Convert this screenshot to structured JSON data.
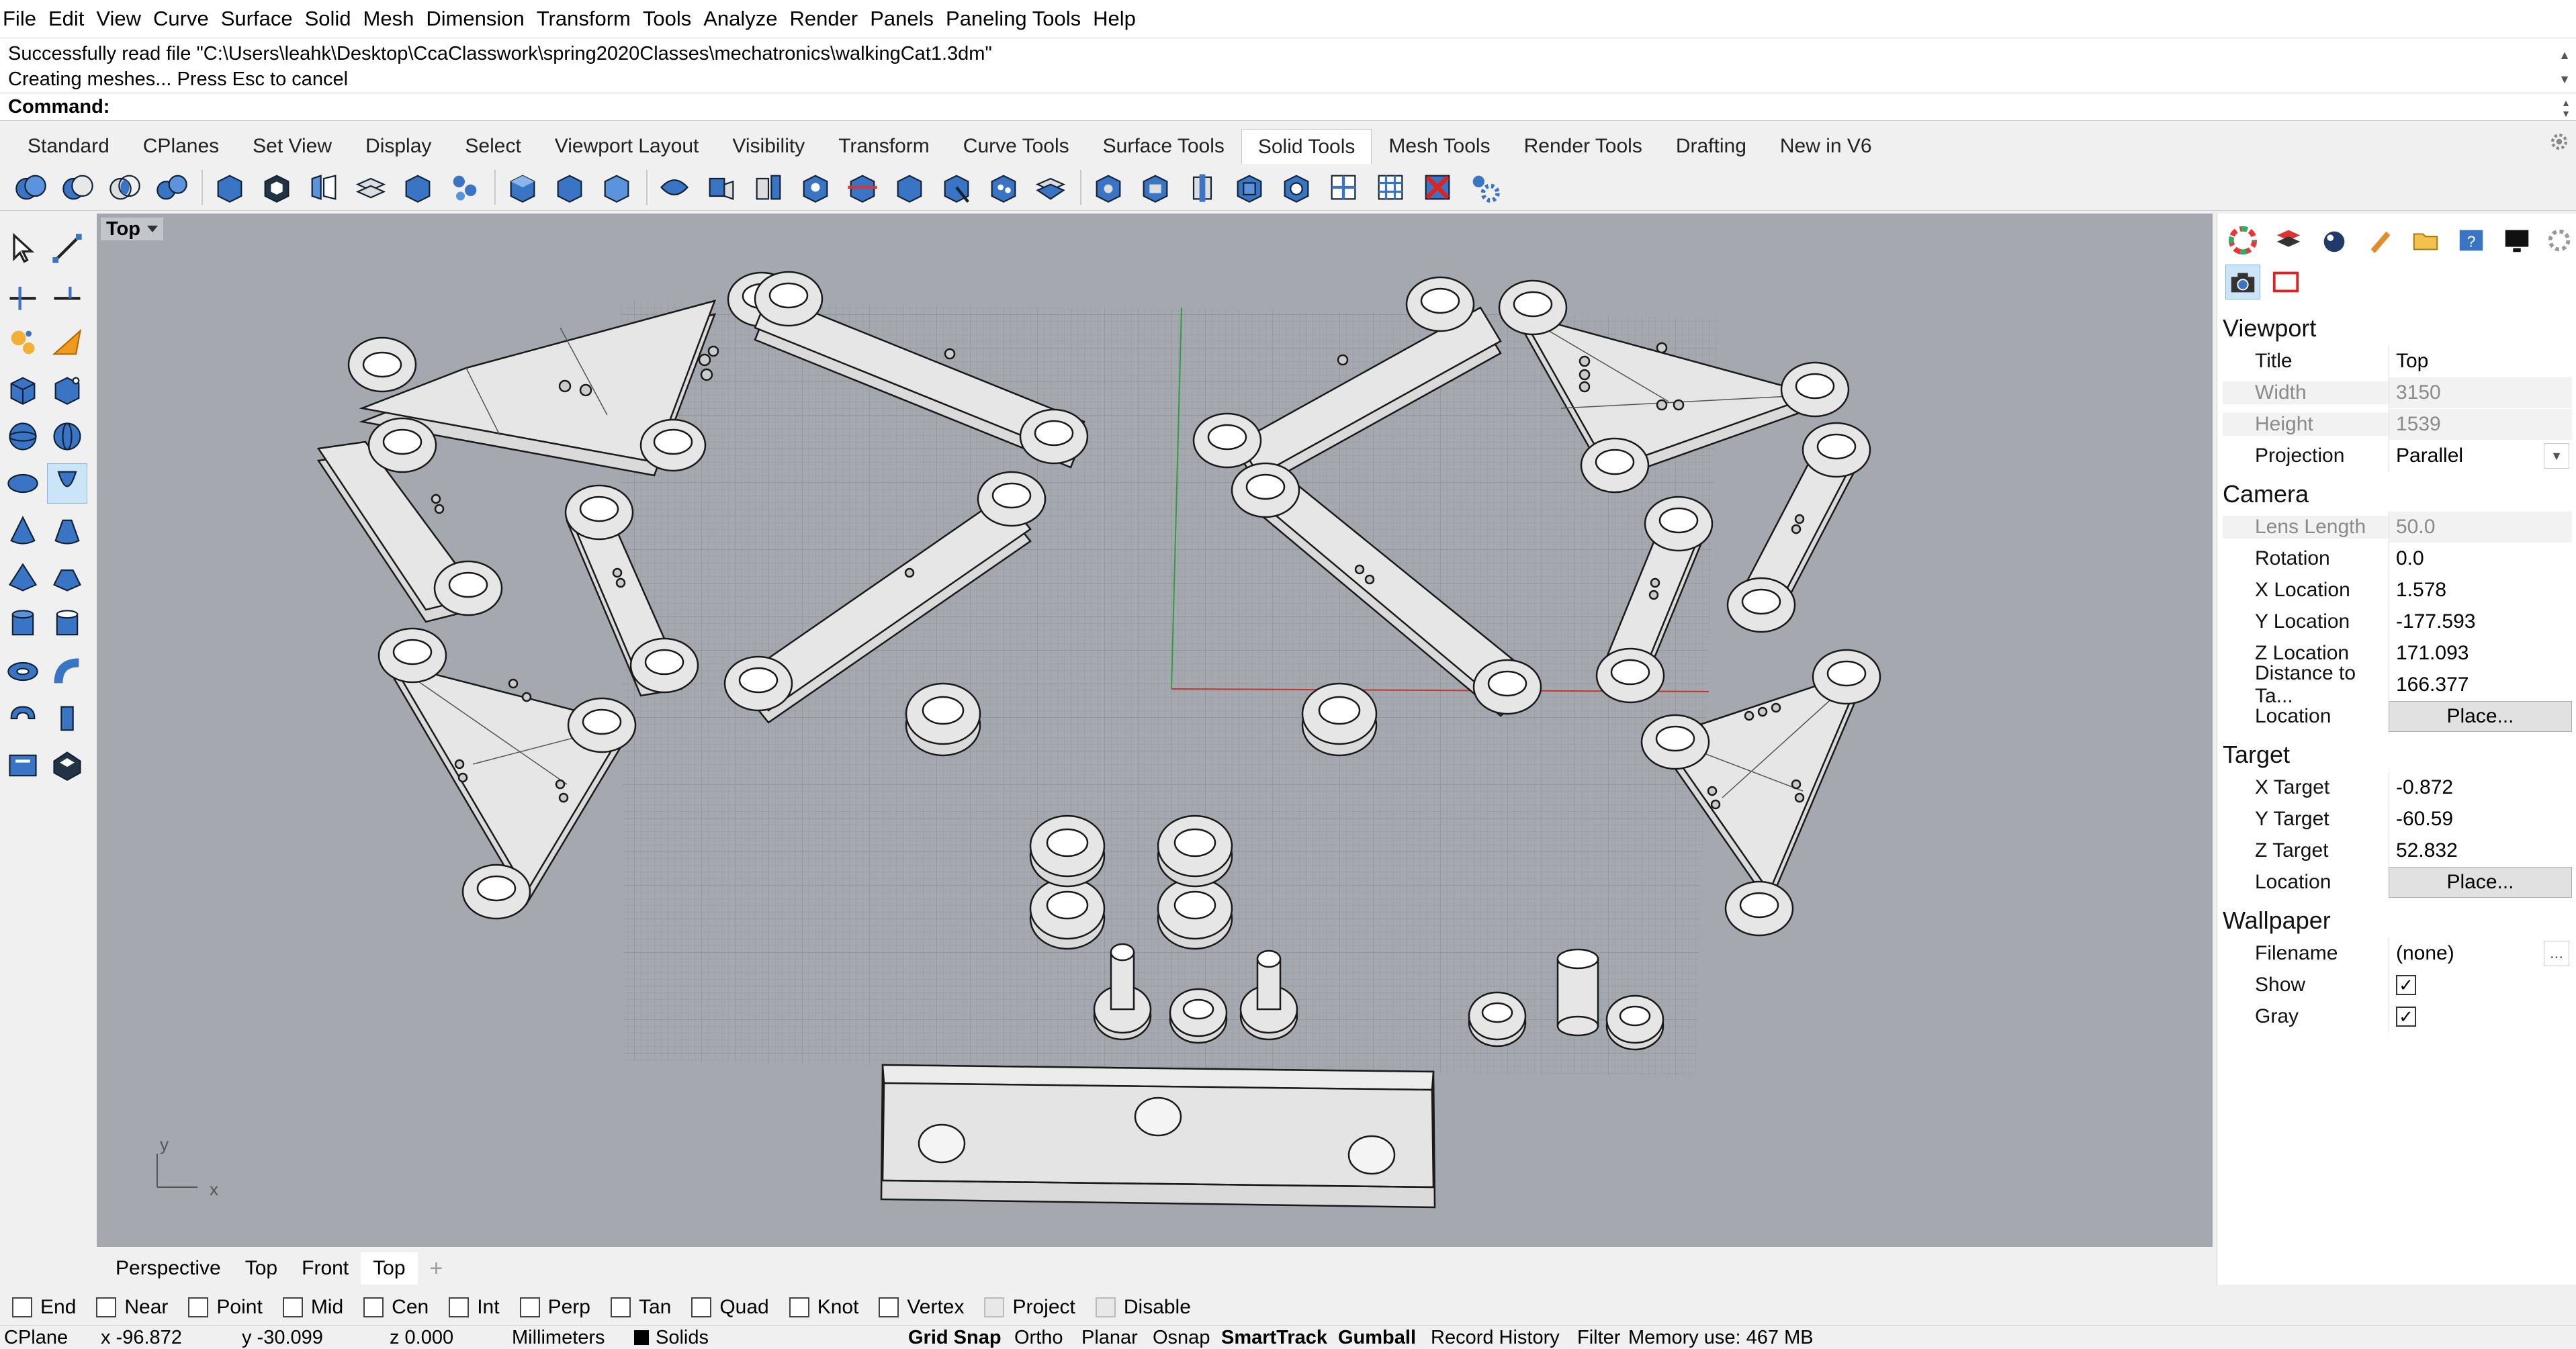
{
  "menu": [
    "File",
    "Edit",
    "View",
    "Curve",
    "Surface",
    "Solid",
    "Mesh",
    "Dimension",
    "Transform",
    "Tools",
    "Analyze",
    "Render",
    "Panels",
    "Paneling Tools",
    "Help"
  ],
  "command_history": [
    "Successfully read file \"C:\\Users\\leahk\\Desktop\\CcaClasswork\\spring2020Classes\\mechatronics\\walkingCat1.3dm\"",
    "Creating meshes... Press Esc to cancel"
  ],
  "command_prompt": "Command:",
  "toolbar_tabs": [
    "Standard",
    "CPlanes",
    "Set View",
    "Display",
    "Select",
    "Viewport Layout",
    "Visibility",
    "Transform",
    "Curve Tools",
    "Surface Tools",
    "Solid Tools",
    "Mesh Tools",
    "Render Tools",
    "Drafting",
    "New in V6"
  ],
  "active_toolbar_tab": "Solid Tools",
  "viewport": {
    "label": "Top",
    "axis_x": "x",
    "axis_y": "y"
  },
  "viewport_tabs": [
    "Perspective",
    "Top",
    "Front",
    "Top"
  ],
  "active_viewport_tab": "Top",
  "properties": {
    "viewport_header": "Viewport",
    "viewport_rows": [
      {
        "key": "Title",
        "value": "Top"
      },
      {
        "key": "Width",
        "value": "3150"
      },
      {
        "key": "Height",
        "value": "1539"
      },
      {
        "key": "Projection",
        "value": "Parallel"
      }
    ],
    "camera_header": "Camera",
    "camera_rows": [
      {
        "key": "Lens Length",
        "value": "50.0"
      },
      {
        "key": "Rotation",
        "value": "0.0"
      },
      {
        "key": "X Location",
        "value": "1.578"
      },
      {
        "key": "Y Location",
        "value": "-177.593"
      },
      {
        "key": "Z Location",
        "value": "171.093"
      },
      {
        "key": "Distance to Ta...",
        "value": "166.377"
      },
      {
        "key": "Location",
        "value": "Place..."
      }
    ],
    "target_header": "Target",
    "target_rows": [
      {
        "key": "X Target",
        "value": "-0.872"
      },
      {
        "key": "Y Target",
        "value": "-60.59"
      },
      {
        "key": "Z Target",
        "value": "52.832"
      },
      {
        "key": "Location",
        "value": "Place..."
      }
    ],
    "wallpaper_header": "Wallpaper",
    "wallpaper_rows": [
      {
        "key": "Filename",
        "value": "(none)",
        "button": "..."
      },
      {
        "key": "Show",
        "checked": true
      },
      {
        "key": "Gray",
        "checked": true
      }
    ]
  },
  "osnaps": [
    "End",
    "Near",
    "Point",
    "Mid",
    "Cen",
    "Int",
    "Perp",
    "Tan",
    "Quad",
    "Knot",
    "Vertex",
    "Project",
    "Disable"
  ],
  "status": {
    "cplane": "CPlane",
    "x": "x -96.872",
    "y": "y -30.099",
    "z": "z 0.000",
    "units": "Millimeters",
    "layer": "Solids",
    "grid_snap": "Grid Snap",
    "ortho": "Ortho",
    "planar": "Planar",
    "osnap": "Osnap",
    "smarttrack": "SmartTrack",
    "gumball": "Gumball",
    "record_history": "Record History",
    "filter": "Filter",
    "memory": "Memory use: 467 MB"
  },
  "colors": {
    "viewport_bg": "#a5a8ae",
    "part_fill": "#e6e6e6",
    "part_edge": "#1a1a1a",
    "grid": "#9a9da3",
    "x_axis": "#c0392b",
    "y_axis": "#27ae60"
  }
}
